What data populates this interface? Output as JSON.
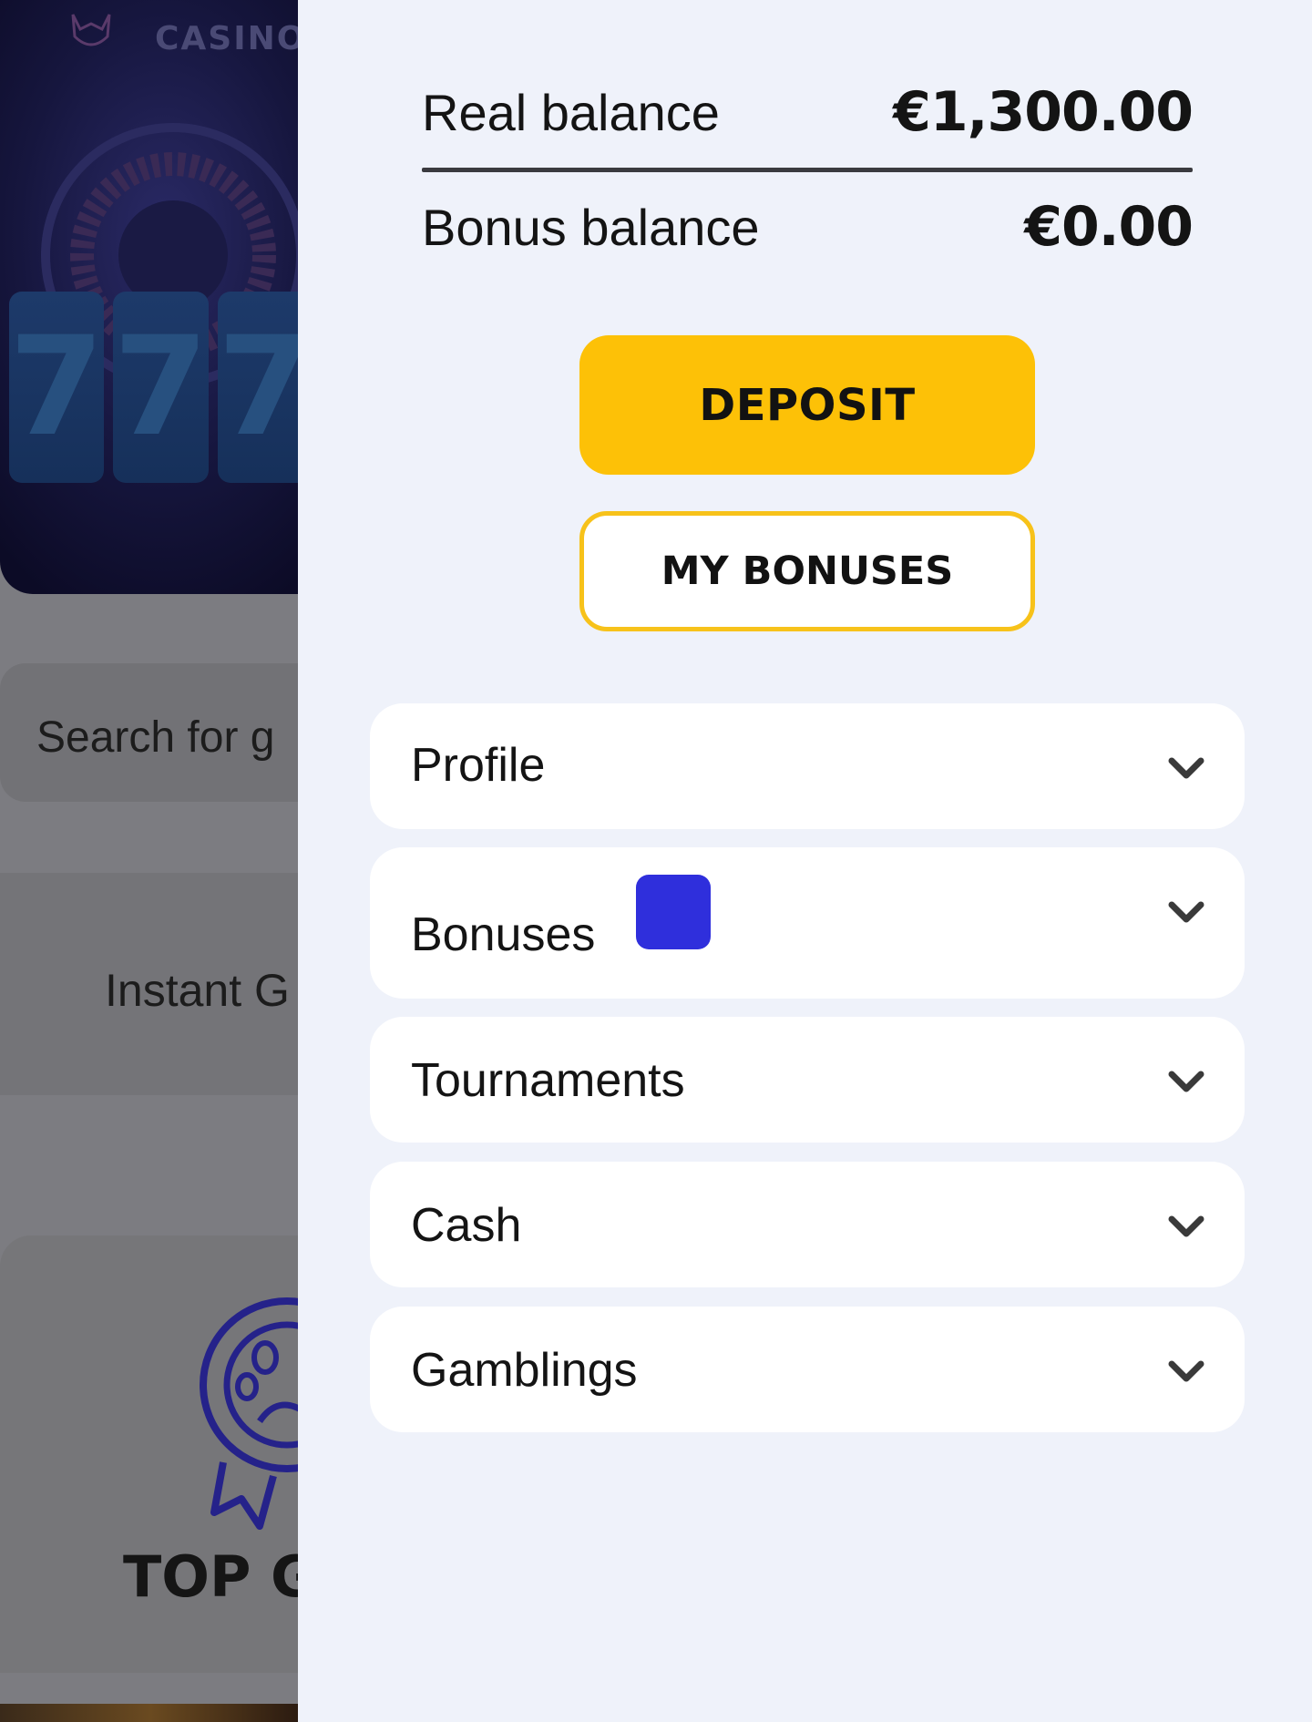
{
  "background": {
    "brand_text": "CASINO",
    "search_placeholder": "Search for g",
    "instant_label": "Instant G",
    "top_label": "TOP G",
    "reels": [
      "7",
      "7",
      "7"
    ]
  },
  "balance": {
    "real_label": "Real balance",
    "real_amount": "€1,300.00",
    "bonus_label": "Bonus balance",
    "bonus_amount": "€0.00"
  },
  "buttons": {
    "deposit": "DEPOSIT",
    "my_bonuses": "MY BONUSES"
  },
  "menu": {
    "items": [
      {
        "label": "Profile",
        "icon": "chevron-down-icon"
      },
      {
        "label": "Bonuses",
        "icon": "chevron-down-icon"
      },
      {
        "label": "Tournaments",
        "icon": "chevron-down-icon"
      },
      {
        "label": "Cash",
        "icon": "chevron-down-icon"
      },
      {
        "label": "Gamblings",
        "icon": "chevron-down-icon"
      }
    ]
  },
  "colors": {
    "deposit_bg": "#fdc107",
    "bonuses_border": "#f7c21a",
    "badge": "#2f2fdc",
    "drawer_bg": "#eff2fa",
    "overlay_dim": "#7c7c81"
  }
}
